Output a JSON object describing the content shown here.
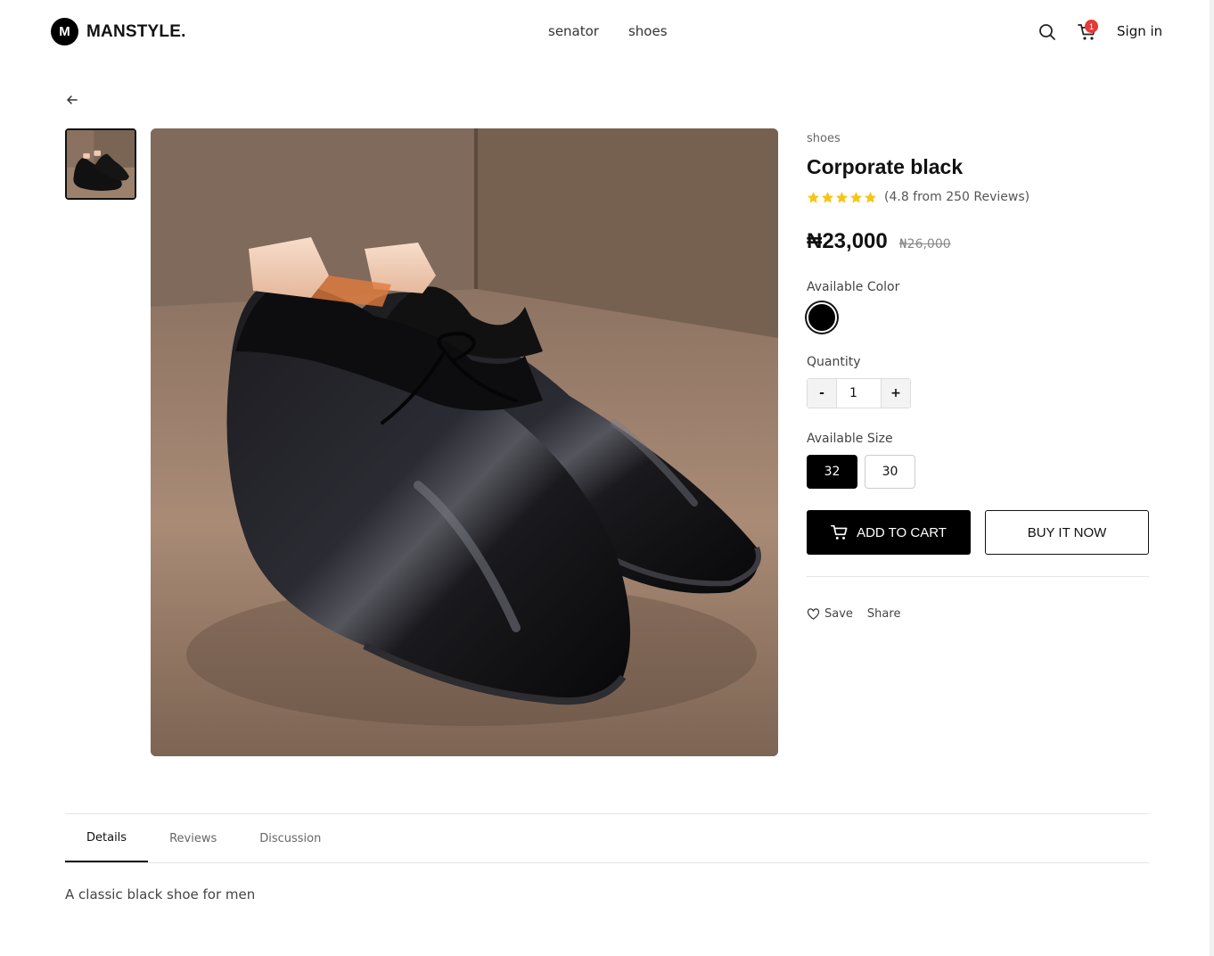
{
  "header": {
    "logo_mark": "M",
    "brand": "MANSTYLE.",
    "nav": [
      {
        "label": "senator"
      },
      {
        "label": "shoes"
      }
    ],
    "cart_count": "1",
    "signin_label": "Sign in",
    "icons": [
      "search-icon",
      "cart-icon"
    ]
  },
  "product": {
    "category": "shoes",
    "title": "Corporate black",
    "rating": 4.8,
    "stars_shown": 5,
    "rating_text": "(4.8 from 250 Reviews)",
    "price": "₦23,000",
    "old_price": "₦26,000",
    "color_label": "Available Color",
    "colors": [
      {
        "name": "black",
        "hex": "#000000",
        "selected": true
      }
    ],
    "quantity_label": "Quantity",
    "quantity_minus": "-",
    "quantity_value": "1",
    "quantity_plus": "+",
    "size_label": "Available Size",
    "sizes": [
      {
        "label": "32",
        "selected": true
      },
      {
        "label": "30",
        "selected": false
      }
    ],
    "add_to_cart_label": "ADD TO CART",
    "buy_now_label": "BUY IT NOW",
    "save_label": "Save",
    "share_label": "Share"
  },
  "tabs": [
    {
      "label": "Details",
      "active": true
    },
    {
      "label": "Reviews",
      "active": false
    },
    {
      "label": "Discussion",
      "active": false
    }
  ],
  "details_text": "A classic black shoe for men",
  "colors": {
    "accent": "#000000",
    "badge": "#e53935",
    "star": "#f5c518"
  }
}
